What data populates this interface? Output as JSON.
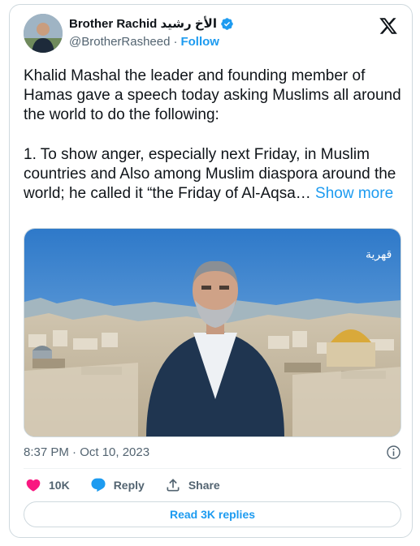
{
  "author": {
    "display_name": "Brother Rachid الأخ رشيد",
    "handle": "@BrotherRasheed",
    "separator": "·",
    "follow_label": "Follow"
  },
  "tweet": {
    "text": "Khalid Mashal the leader and founding member of Hamas gave a speech today asking Muslims all around the world to do the following:\n\n1. To show anger, especially next Friday, in Muslim countries and Also among Muslim diaspora around the world; he called it “the Friday of Al-Aqsa… ",
    "show_more_label": "Show more",
    "timestamp": "8:37 PM · Oct 10, 2023"
  },
  "media": {
    "watermark": "قهرية"
  },
  "actions": {
    "likes": "10K",
    "reply_label": "Reply",
    "share_label": "Share"
  },
  "read_replies_label": "Read 3K replies",
  "colors": {
    "accent": "#1d9bf0",
    "like": "#f91880",
    "text": "#0f1419",
    "secondary": "#536471"
  }
}
